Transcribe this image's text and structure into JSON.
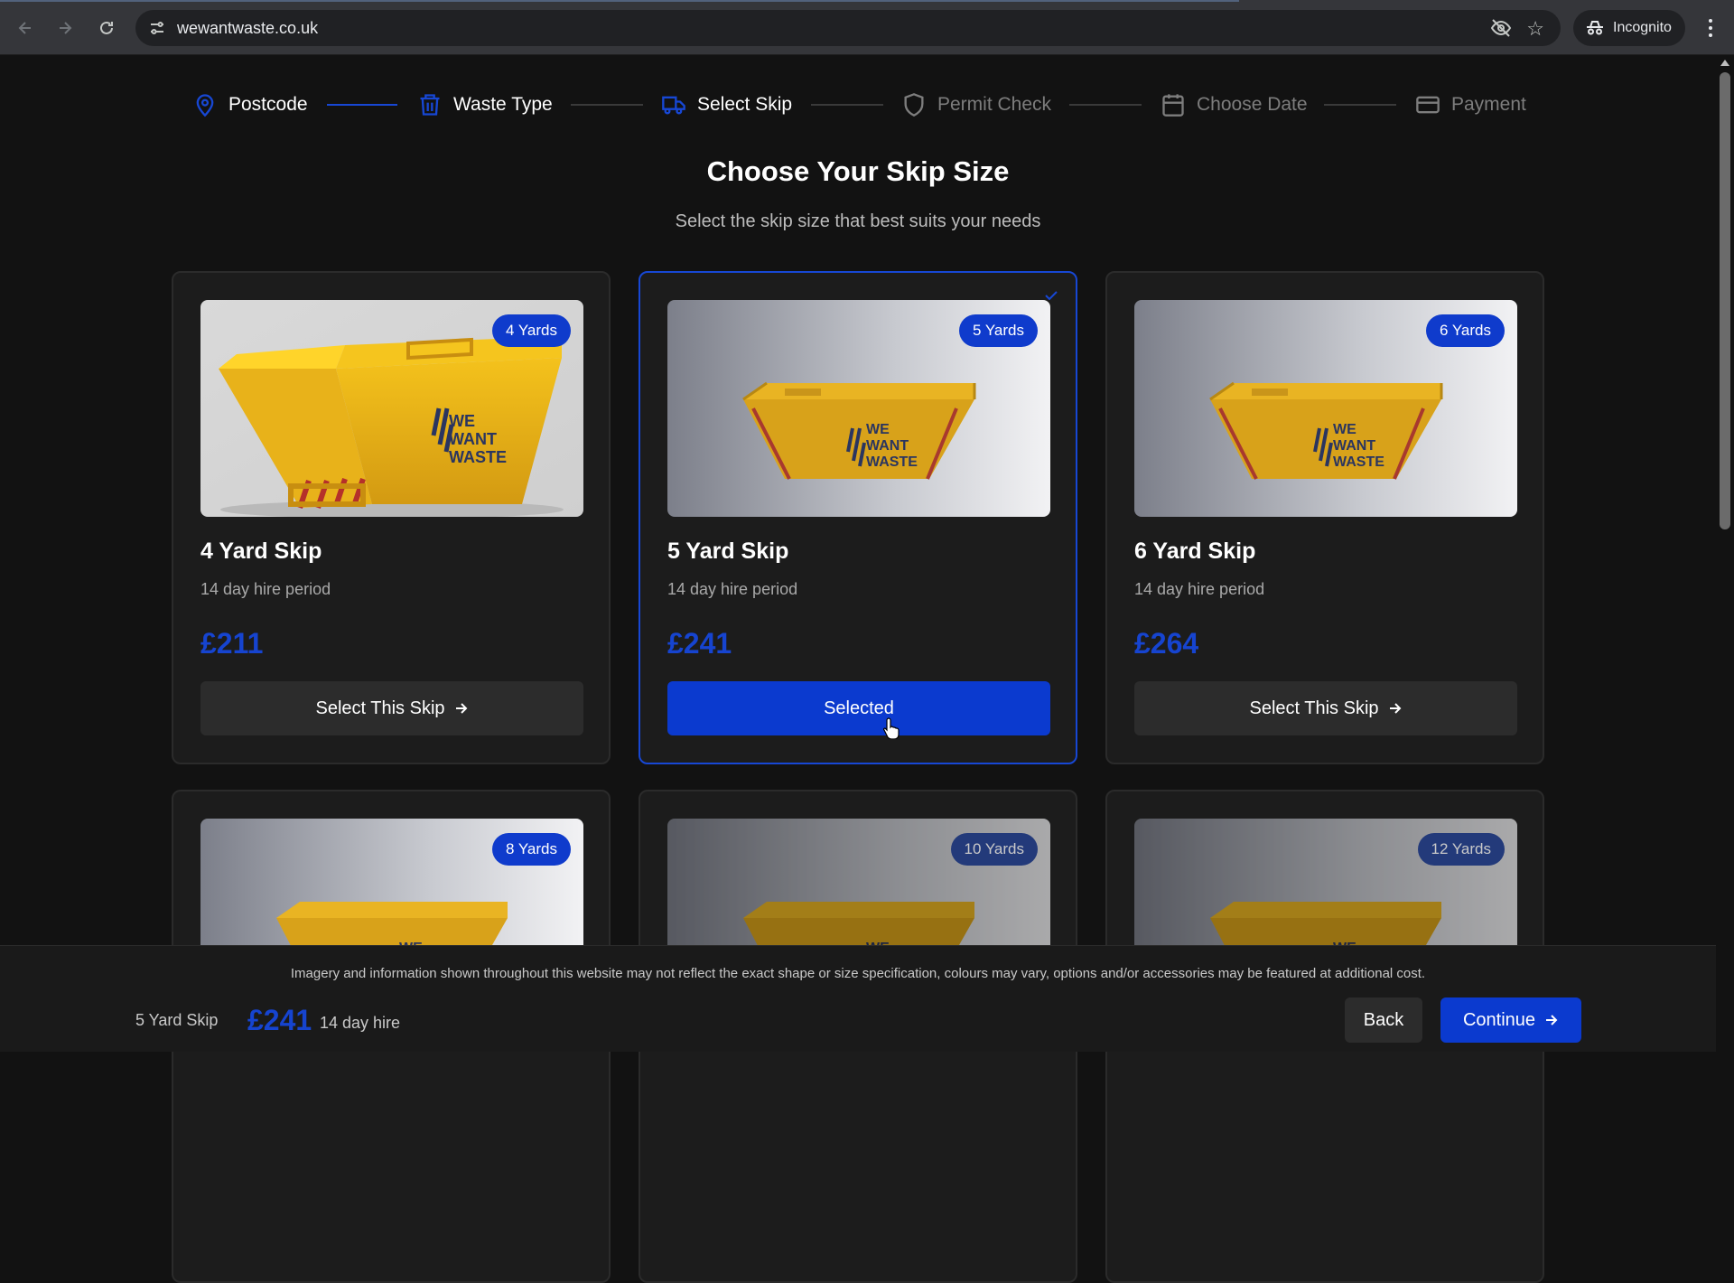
{
  "browser": {
    "url": "wewantwaste.co.uk",
    "profile_label": "Incognito",
    "icons": [
      "back-icon",
      "forward-icon",
      "reload-icon",
      "site-settings-icon",
      "eye-off-icon",
      "star-icon",
      "incognito-icon",
      "more-menu-icon"
    ]
  },
  "steps": [
    {
      "label": "Postcode",
      "icon": "map-pin-icon",
      "state": "done"
    },
    {
      "label": "Waste Type",
      "icon": "trash-icon",
      "state": "done"
    },
    {
      "label": "Select Skip",
      "icon": "truck-icon",
      "state": "current"
    },
    {
      "label": "Permit Check",
      "icon": "shield-icon",
      "state": "todo"
    },
    {
      "label": "Choose Date",
      "icon": "calendar-icon",
      "state": "todo"
    },
    {
      "label": "Payment",
      "icon": "credit-card-icon",
      "state": "todo"
    }
  ],
  "page": {
    "title": "Choose Your Skip Size",
    "subtitle": "Select the skip size that best suits your needs"
  },
  "skips": [
    {
      "badge": "4 Yards",
      "name": "4 Yard Skip",
      "hire": "14 day hire period",
      "price": "£211",
      "button": "Select This Skip",
      "selected": false
    },
    {
      "badge": "5 Yards",
      "name": "5 Yard Skip",
      "hire": "14 day hire period",
      "price": "£241",
      "button": "Selected",
      "selected": true
    },
    {
      "badge": "6 Yards",
      "name": "6 Yard Skip",
      "hire": "14 day hire period",
      "price": "£264",
      "button": "Select This Skip",
      "selected": false
    },
    {
      "badge": "8 Yards"
    },
    {
      "badge": "10 Yards"
    },
    {
      "badge": "12 Yards"
    }
  ],
  "footer": {
    "disclaimer": "Imagery and information shown throughout this website may not reflect the exact shape or size specification, colours may vary, options and/or accessories may be featured at additional cost.",
    "selected_name": "5 Yard Skip",
    "selected_price": "£241",
    "selected_hire": "14 day hire",
    "back_label": "Back",
    "continue_label": "Continue"
  },
  "colors": {
    "accent": "#0b3acf",
    "price": "#1644d0",
    "background": "#121212",
    "card": "#1c1c1c"
  }
}
